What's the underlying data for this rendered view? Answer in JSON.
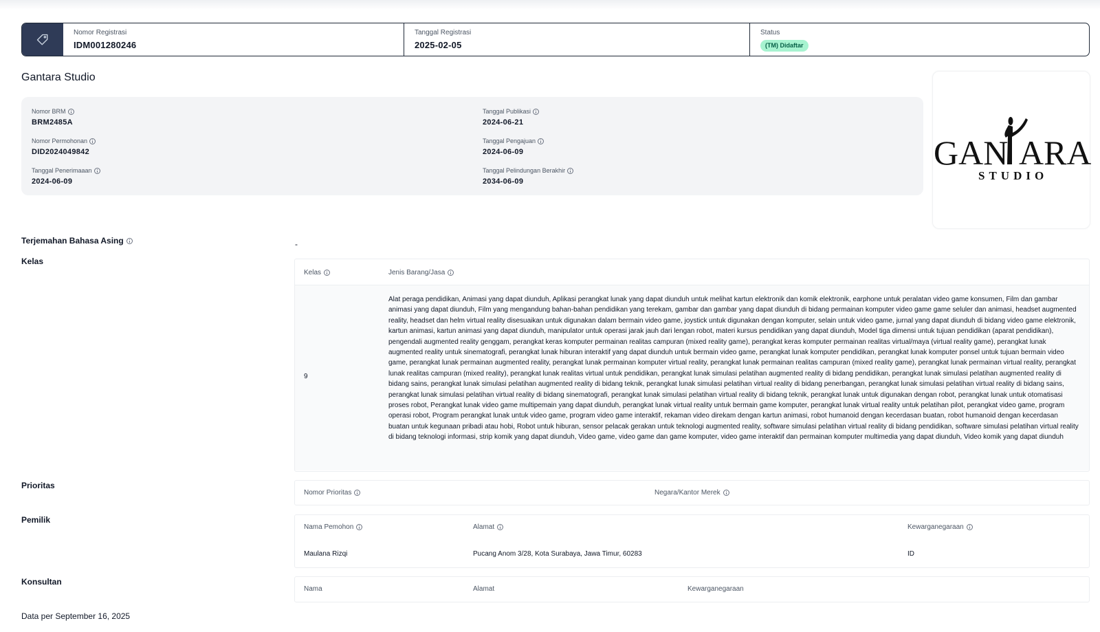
{
  "registration": {
    "number_label": "Nomor Registrasi",
    "number": "IDM001280246",
    "date_label": "Tanggal Registrasi",
    "date": "2025-02-05",
    "status_label": "Status",
    "status": "(TM) Didaftar"
  },
  "owner_title": "Gantara Studio",
  "details": {
    "brm_label": "Nomor BRM",
    "brm": "BRM2485A",
    "permohonan_label": "Nomor Permohonan",
    "permohonan": "DID2024049842",
    "penerimaan_label": "Tanggal Penerimaaan",
    "penerimaan": "2024-06-09",
    "publikasi_label": "Tanggal Publikasi",
    "publikasi": "2024-06-21",
    "pengajuan_label": "Tanggal Pengajuan",
    "pengajuan": "2024-06-09",
    "perlindungan_label": "Tanggal Pelindungan Berakhir",
    "perlindungan": "2034-06-09"
  },
  "logo": {
    "word_left": "GAN",
    "word_right": "ARA",
    "sub": "STUDIO"
  },
  "terjemahan": {
    "label": "Terjemahan Bahasa Asing",
    "value": "-"
  },
  "kelas": {
    "label": "Kelas",
    "col_kelas": "Kelas",
    "col_jenis": "Jenis Barang/Jasa",
    "class_number": "9",
    "goods": "Alat peraga pendidikan, Animasi yang dapat diunduh, Aplikasi perangkat lunak yang dapat diunduh untuk melihat kartun elektronik dan komik elektronik, earphone untuk peralatan video game konsumen, Film dan gambar animasi yang dapat diunduh, Film yang mengandung bahan-bahan pendidikan yang terekam, gambar dan gambar yang dapat diunduh di bidang permainan komputer video game game seluler dan animasi, headset augmented reality, headset dan helm virtual reality disesuaikan untuk digunakan dalam bermain video game, joystick untuk digunakan dengan komputer, selain untuk video game, jurnal yang dapat diunduh di bidang video game elektronik, kartun animasi, kartun animasi yang dapat diunduh, manipulator untuk operasi jarak jauh dari lengan robot, materi kursus pendidikan yang dapat diunduh, Model tiga dimensi untuk tujuan pendidikan (aparat pendidikan), pengendali augmented reality genggam, perangkat keras komputer permainan realitas campuran (mixed reality game), perangkat keras komputer permainan realitas virtual/maya (virtual reality game), perangkat lunak augmented reality untuk sinematografi, perangkat lunak hiburan interaktif yang dapat diunduh untuk bermain video game, perangkat lunak komputer pendidikan, perangkat lunak komputer ponsel untuk tujuan bermain video game, perangkat lunak permainan augmented reality, perangkat lunak permainan komputer virtual reality, perangkat lunak permainan realitas campuran (mixed reality game), perangkat lunak permainan virtual reality, perangkat lunak realitas campuran (mixed reality), perangkat lunak realitas virtual untuk pendidikan, perangkat lunak simulasi pelatihan augmented reality di bidang pendidikan, perangkat lunak simulasi pelatihan augmented reality di bidang sains, perangkat lunak simulasi pelatihan augmented reality di bidang teknik, perangkat lunak simulasi pelatihan virtual reality di bidang penerbangan, perangkat lunak simulasi pelatihan virtual reality di bidang sains, perangkat lunak simulasi pelatihan virtual reality di bidang sinematografi, perangkat lunak simulasi pelatihan virtual reality di bidang teknik, perangkat lunak untuk digunakan dengan robot, perangkat lunak untuk otomatisasi proses robot, Perangkat lunak video game multipemain yang dapat diunduh, perangkat lunak virtual reality untuk bermain game komputer, perangkat lunak virtual reality untuk pelatihan pilot, perangkat video game, program operasi robot, Program perangkat lunak untuk video game, program video game interaktif, rekaman video direkam dengan kartun animasi, robot humanoid dengan kecerdasan buatan, robot humanoid dengan kecerdasan buatan untuk kegunaan pribadi atau hobi, Robot untuk hiburan, sensor pelacak gerakan untuk teknologi augmented reality, software simulasi pelatihan virtual reality di bidang pendidikan, software simulasi pelatihan virtual reality di bidang teknologi informasi, strip komik yang dapat diunduh, Video game, video game dan game komputer, video game interaktif dan permainan komputer multimedia yang dapat diunduh, Video komik yang dapat diunduh"
  },
  "prioritas": {
    "label": "Prioritas",
    "col_nomor": "Nomor Prioritas",
    "col_negara": "Negara/Kantor Merek"
  },
  "pemilik": {
    "label": "Pemilik",
    "col_nama": "Nama Pemohon",
    "col_alamat": "Alamat",
    "col_kewarganegaraan": "Kewarganegaraan",
    "nama": "Maulana Rizqi",
    "alamat": "Pucang Anom 3/28, Kota Surabaya, Jawa Timur, 60283",
    "kewarganegaraan": "ID"
  },
  "konsultan": {
    "label": "Konsultan",
    "col_nama": "Nama",
    "col_alamat": "Alamat",
    "col_kewarganegaraan": "Kewarganegaraan"
  },
  "footer": "Data per September 16, 2025"
}
